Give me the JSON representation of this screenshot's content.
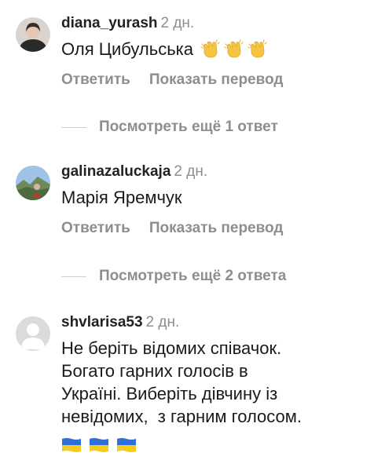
{
  "comments": [
    {
      "username": "diana_yurash",
      "time": "2 дн.",
      "text": "Оля Цибульська",
      "emoji": [
        "clapping-hands",
        "clapping-hands",
        "clapping-hands"
      ],
      "reply_label": "Ответить",
      "translate_label": "Показать перевод"
    },
    {
      "username": "galinazaluckaja",
      "time": "2 дн.",
      "text": "Марія Яремчук",
      "reply_label": "Ответить",
      "translate_label": "Показать перевод"
    },
    {
      "username": "shvlarisa53",
      "time": "2 дн.",
      "text_lines": [
        "Не беріть відомих співачок.",
        "Богато гарних голосів в",
        "Україні. Виберіть дівчину із",
        "невідомих,  з гарним голосом."
      ],
      "emoji": [
        "ukraine-flag",
        "ukraine-flag",
        "ukraine-flag"
      ]
    }
  ],
  "view_replies": [
    "Посмотреть ещё 1 ответ",
    "Посмотреть ещё 2 ответа"
  ],
  "colors": {
    "muted": "#8e8e8e",
    "text": "#1a1a1a",
    "flag_blue": "#2f6fd6",
    "flag_yellow": "#f6cc1c"
  }
}
